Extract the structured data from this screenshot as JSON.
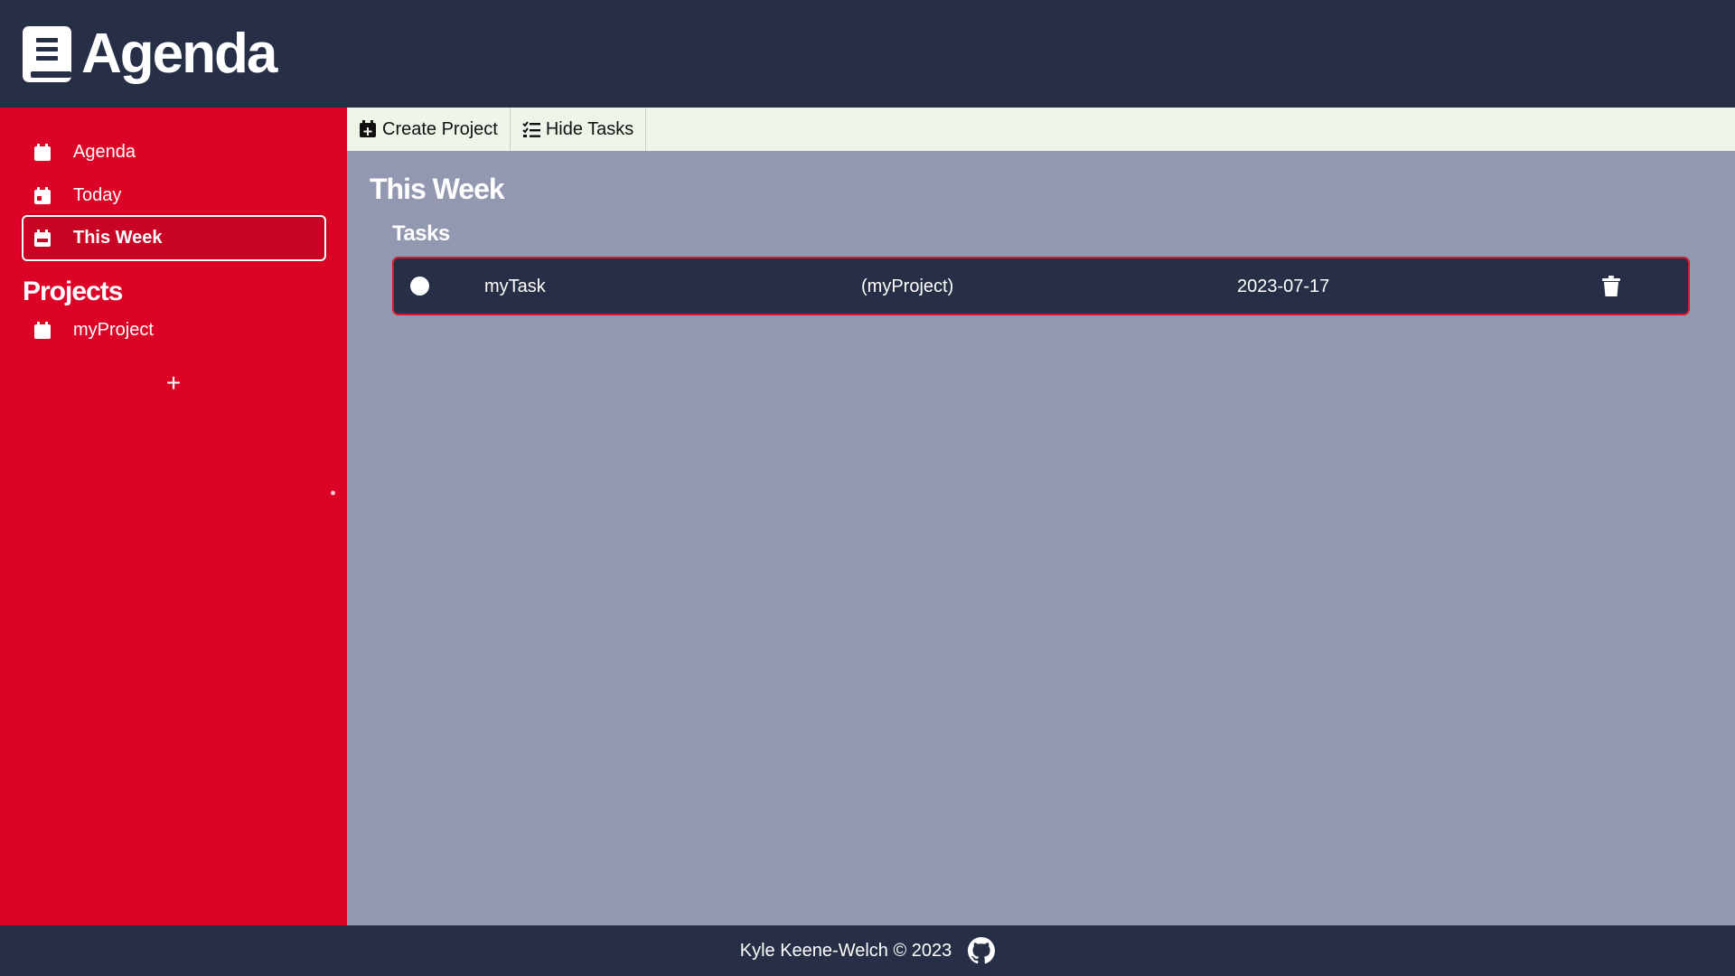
{
  "header": {
    "title": "Agenda",
    "logo_icon": "book-icon"
  },
  "sidebar": {
    "items": [
      {
        "label": "Agenda",
        "icon": "calendar-icon",
        "active": false
      },
      {
        "label": "Today",
        "icon": "calendar-icon",
        "active": false
      },
      {
        "label": "This Week",
        "icon": "calendar-week-icon",
        "active": true
      }
    ],
    "projects_title": "Projects",
    "projects": [
      {
        "label": "myProject",
        "icon": "calendar-icon"
      }
    ],
    "add_label": "+"
  },
  "toolbar": {
    "create_project_label": "Create Project",
    "hide_tasks_label": "Hide Tasks"
  },
  "main": {
    "title": "This Week",
    "tasks_title": "Tasks",
    "tasks": [
      {
        "name": "myTask",
        "project": "(myProject)",
        "date": "2023-07-17"
      }
    ]
  },
  "footer": {
    "text": "Kyle Keene-Welch © 2023",
    "icon": "github-icon"
  },
  "colors": {
    "header_bg": "#262f45",
    "sidebar_bg": "#dc0326",
    "main_bg": "#9398b1",
    "toolbar_bg": "#eef6ea",
    "task_border": "#d61a2c"
  }
}
